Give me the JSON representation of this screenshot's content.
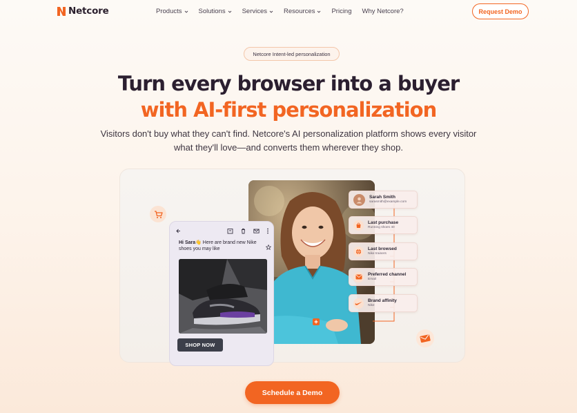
{
  "brand": {
    "name": "Netcore",
    "accent": "#f26522",
    "dark": "#2b1f30"
  },
  "nav": {
    "items": [
      {
        "label": "Products",
        "dropdown": true
      },
      {
        "label": "Solutions",
        "dropdown": true
      },
      {
        "label": "Services",
        "dropdown": true
      },
      {
        "label": "Resources",
        "dropdown": true
      },
      {
        "label": "Pricing",
        "dropdown": false
      },
      {
        "label": "Why Netcore?",
        "dropdown": false
      }
    ],
    "cta_label": "Request Demo"
  },
  "hero": {
    "pill": "Netcore Intent-led personalization",
    "title_line1": "Turn every browser into a buyer",
    "title_line2": "with AI-first personalization",
    "subtitle": "Visitors don't buy what they can't find. Netcore's AI personalization platform shows every visitor what they'll love—and converts them wherever they shop."
  },
  "phone": {
    "greeting_name": "Hi Sara",
    "greeting_text": "Here are brand new Nike shoes you may like",
    "button_label": "SHOP NOW"
  },
  "profile_chips": [
    {
      "title": "Sarah Smith",
      "subtitle": "sarasmith@example.com",
      "icon": "avatar-icon"
    },
    {
      "title": "Last purchase",
      "subtitle": "Running shoes 40",
      "icon": "shopping-bag-icon"
    },
    {
      "title": "Last browsed",
      "subtitle": "Nike trainers",
      "icon": "globe-icon"
    },
    {
      "title": "Preferred channel",
      "subtitle": "Email",
      "icon": "envelope-icon"
    },
    {
      "title": "Brand affinity",
      "subtitle": "Nike",
      "icon": "nike-swoosh-icon"
    }
  ],
  "cta": {
    "label": "Schedule a Demo"
  }
}
